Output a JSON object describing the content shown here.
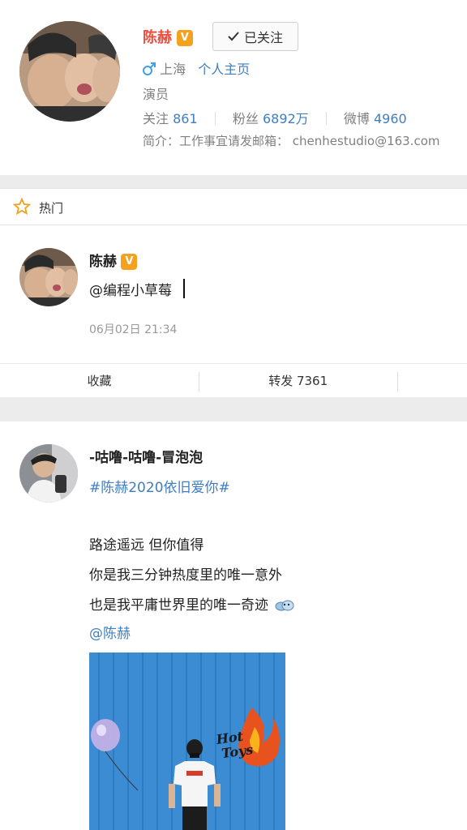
{
  "profile": {
    "name": "陈赫",
    "verified_badge": "V",
    "follow_button": "已关注",
    "gender_icon": "male-icon",
    "location": "上海",
    "homepage_link": "个人主页",
    "occupation": "演员",
    "stats": [
      {
        "label": "关注",
        "value": "861"
      },
      {
        "label": "粉丝",
        "value": "6892万"
      },
      {
        "label": "微博",
        "value": "4960"
      }
    ],
    "bio": "简介：工作事宜请发邮箱：",
    "email": "chenhestudio@163.com"
  },
  "hot_section": {
    "icon": "star-icon",
    "label": "热门"
  },
  "post1": {
    "author": "陈赫",
    "verified_badge": "V",
    "text": "@编程小草莓",
    "time": "06月02日 21:34",
    "actions": [
      {
        "label": "收藏"
      },
      {
        "label": "转发 7361"
      }
    ]
  },
  "post2": {
    "author": "-咕噜-咕噜-冒泡泡",
    "topic": "#陈赫2020依旧爱你#",
    "lines": [
      "路途遥远 但你值得",
      "你是我三分钟热度里的唯一意外",
      "也是我平庸世界里的唯一奇迹"
    ],
    "mention": "@陈赫",
    "photo_sign_line1": "Hot",
    "photo_sign_line2": "Toys"
  },
  "colors": {
    "accent_red": "#eb4f3e",
    "link_blue": "#3e7ec2",
    "badge_orange": "#f4a21e",
    "photo_wall": "#3b8cd2"
  }
}
